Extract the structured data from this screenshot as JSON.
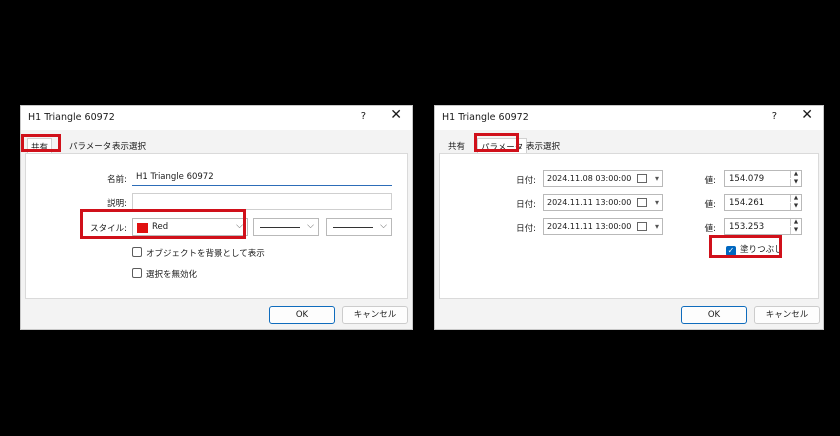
{
  "dialog_common": {
    "title": "H1 Triangle 60972",
    "help": "?",
    "close": "✕",
    "tabs": [
      "共有",
      "パラメータ",
      "表示選択"
    ],
    "name_label": "名前:",
    "name_value": "H1 Triangle 60972",
    "desc_label": "説明:",
    "desc_value": "",
    "style_label": "スタイル:",
    "color_value": "Red",
    "color_hex": "#e01010",
    "checkbox_background": "オブジェクトを背景として表示",
    "checkbox_disable_select": "選択を無効化",
    "ok": "OK",
    "cancel": "キャンセル"
  },
  "dialog_params": {
    "title": "H1 Triangle 60972",
    "help": "?",
    "close": "✕",
    "tabs": [
      "共有",
      "パラメータ",
      "表示選択"
    ],
    "points": [
      {
        "date_label": "日付:",
        "date": "2024.11.08 03:00:00",
        "value_label": "値:",
        "value": "154.079"
      },
      {
        "date_label": "日付:",
        "date": "2024.11.11 13:00:00",
        "value_label": "値:",
        "value": "154.261"
      },
      {
        "date_label": "日付:",
        "date": "2024.11.11 13:00:00",
        "value_label": "値:",
        "value": "153.253"
      }
    ],
    "fill_label": "塗りつぶし",
    "fill_checked": true,
    "ok": "OK",
    "cancel": "キャンセル"
  },
  "highlight_color": "#d0101a"
}
